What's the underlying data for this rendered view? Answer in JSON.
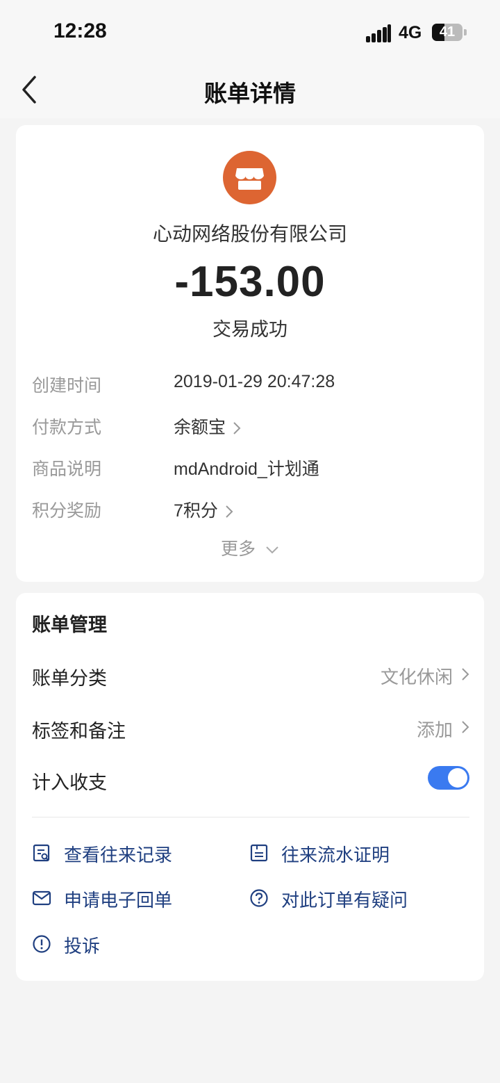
{
  "status_bar": {
    "time": "12:28",
    "network": "4G",
    "battery": "41",
    "battery_level": 0.41
  },
  "nav": {
    "title": "账单详情"
  },
  "summary": {
    "merchant": "心动网络股份有限公司",
    "amount": "-153.00",
    "status": "交易成功",
    "details": [
      {
        "label": "创建时间",
        "value": "2019-01-29 20:47:28",
        "has_arrow": false
      },
      {
        "label": "付款方式",
        "value": "余额宝",
        "has_arrow": true
      },
      {
        "label": "商品说明",
        "value": "mdAndroid_计划通",
        "has_arrow": false
      },
      {
        "label": "积分奖励",
        "value": "7积分",
        "has_arrow": true
      }
    ],
    "more_label": "更多"
  },
  "management": {
    "title": "账单管理",
    "category": {
      "label": "账单分类",
      "value": "文化休闲"
    },
    "tags": {
      "label": "标签和备注",
      "value": "添加"
    },
    "include": {
      "label": "计入收支",
      "enabled": true
    },
    "links": {
      "records": "查看往来记录",
      "flow_proof": "往来流水证明",
      "receipt": "申请电子回单",
      "question": "对此订单有疑问",
      "complaint": "投诉"
    }
  },
  "colors": {
    "accent": "#3a7af0",
    "merchant_icon": "#dd6532",
    "link": "#1f3f80"
  }
}
